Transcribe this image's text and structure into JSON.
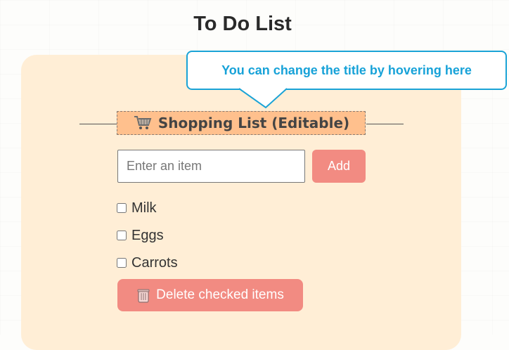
{
  "page": {
    "title": "To Do List"
  },
  "tooltip": {
    "text": "You can change the title by hovering here"
  },
  "list": {
    "title": "Shopping List (Editable)",
    "title_icon": "shopping-cart-icon"
  },
  "input": {
    "placeholder": "Enter an item",
    "value": ""
  },
  "add_button": {
    "label": "Add"
  },
  "items": [
    {
      "label": "Milk",
      "checked": false
    },
    {
      "label": "Eggs",
      "checked": false
    },
    {
      "label": "Carrots",
      "checked": false
    }
  ],
  "delete_button": {
    "label": "Delete checked items",
    "icon": "trash-icon"
  },
  "colors": {
    "accent": "#f28b82",
    "card_bg": "#ffeed6",
    "title_bg": "#ffc08d",
    "tooltip": "#1aa3d6"
  }
}
